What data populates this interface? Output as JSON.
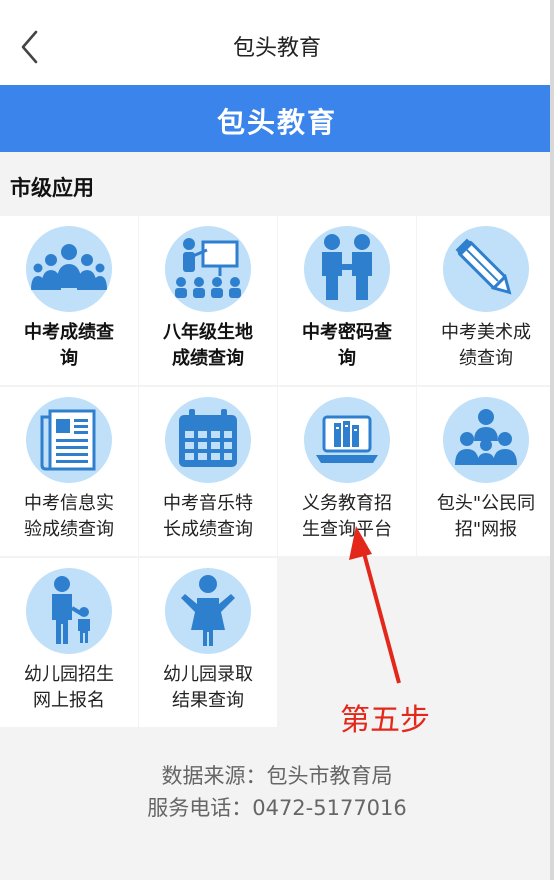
{
  "nav": {
    "title": "包头教育"
  },
  "banner": {
    "title": "包头教育"
  },
  "section": {
    "title": "市级应用"
  },
  "apps": [
    {
      "line1": "中考成绩查",
      "line2": "询",
      "bold": true,
      "icon": "group-people-icon"
    },
    {
      "line1": "八年级生地",
      "line2": "成绩查询",
      "bold": true,
      "icon": "teacher-board-icon"
    },
    {
      "line1": "中考密码查",
      "line2": "询",
      "bold": true,
      "icon": "handshake-icon"
    },
    {
      "line1": "中考美术成",
      "line2": "绩查询",
      "bold": false,
      "icon": "pencil-icon"
    },
    {
      "line1": "中考信息实",
      "line2": "验成绩查询",
      "bold": false,
      "icon": "newspaper-icon"
    },
    {
      "line1": "中考音乐特",
      "line2": "长成绩查询",
      "bold": false,
      "icon": "calendar-icon"
    },
    {
      "line1": "义务教育招",
      "line2": "生查询平台",
      "bold": false,
      "icon": "laptop-books-icon"
    },
    {
      "line1": "包头\"公民同",
      "line2": "招\"网报",
      "bold": false,
      "icon": "family-group-icon"
    },
    {
      "line1": "幼儿园招生",
      "line2": "网上报名",
      "bold": false,
      "icon": "parent-child-icon"
    },
    {
      "line1": "幼儿园录取",
      "line2": "结果查询",
      "bold": false,
      "icon": "child-icon"
    }
  ],
  "footer": {
    "source": "数据来源：包头市教育局",
    "phone": "服务电话：0472-5177016"
  },
  "annotation": {
    "step": "第五步"
  },
  "colors": {
    "accent": "#3a84ec",
    "icon_bg": "#bfe0f8",
    "icon_fg": "#2f7fcf",
    "annotation": "#e3281b"
  }
}
